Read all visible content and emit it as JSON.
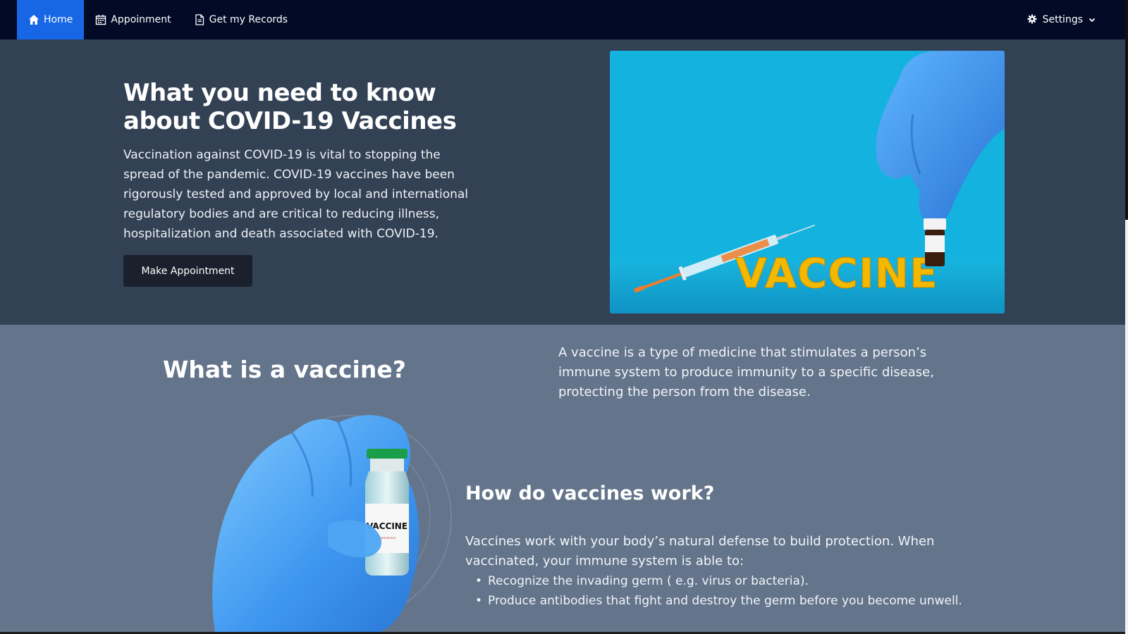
{
  "nav": {
    "home_label": "Home",
    "appointment_label": "Appoinment",
    "records_label": "Get my Records",
    "settings_label": "Settings"
  },
  "hero": {
    "title": "What you need to know about COVID-19 Vaccines",
    "body": "Vaccination against COVID-19 is vital to stopping the spread of the pandemic. COVID-19 vaccines have been rigorously tested and approved by local and international regulatory bodies and are critical to reducing illness, hospitalization and death associated with COVID-19.",
    "button_label": "Make Appointment",
    "photo_word": "VACCINE"
  },
  "info": {
    "title": "What is a vaccine?",
    "description": "A vaccine is a type of medicine that stimulates a person’s immune system to produce immunity to a specific disease, protecting the person from the disease.",
    "vial_label": "VACCINE",
    "vial_sublabel": "Coronavirus"
  },
  "how": {
    "title": "How do vaccines work?",
    "intro": "Vaccines work with your body’s natural defense to build protection. When vaccinated, your immune system is able to:",
    "items": [
      "Recognize the invading germ ( e.g. virus or bacteria).",
      "Produce antibodies that fight and destroy the germ before you become unwell."
    ]
  },
  "colors": {
    "nav_bg": "#020a26",
    "nav_active": "#1766e6",
    "hero_bg": "#334155",
    "info_bg": "#64748b",
    "button_bg": "#1a202c",
    "vaccine_text": "#f5b800"
  },
  "icons": {
    "home": "home-icon",
    "appointment": "calendar-icon",
    "records": "document-icon",
    "settings": "gear-icon",
    "caret": "chevron-down-icon"
  }
}
